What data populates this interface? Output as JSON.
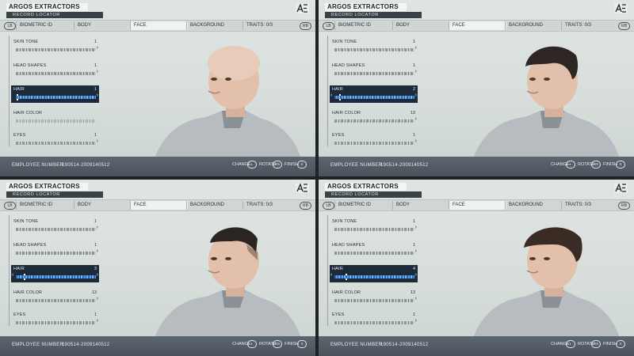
{
  "brand": "ARGOS EXTRACTORS",
  "subtitle": "RECORD LOCATOR",
  "tabs": {
    "lb": "LB",
    "rb": "RB",
    "items": [
      "BIOMETRIC ID",
      "BODY",
      "FACE",
      "BACKGROUND",
      "TRAITS: 0/3"
    ],
    "active": "FACE"
  },
  "footer": {
    "employee_label": "EMPLOYEE NUMBER:",
    "employee_value": "190514-2009140512",
    "change": "CHANGE",
    "rotate": "ROTATE",
    "finish": "FINISH",
    "rotate_key": "RS",
    "finish_key": "X"
  },
  "rows_labels": [
    "SKIN TONE",
    "HEAD SHAPES",
    "HAIR",
    "HAIR COLOR",
    "EYES"
  ],
  "panels": [
    {
      "name": "bald",
      "values": [
        "1",
        "1",
        "1",
        "",
        "1"
      ],
      "hair_style": "none"
    },
    {
      "name": "hair-2",
      "values": [
        "1",
        "1",
        "2",
        "13",
        "1"
      ],
      "hair_style": "short"
    },
    {
      "name": "hair-3",
      "values": [
        "1",
        "1",
        "3",
        "13",
        "1"
      ],
      "hair_style": "fade"
    },
    {
      "name": "hair-4",
      "values": [
        "1",
        "1",
        "4",
        "13",
        "1"
      ],
      "hair_style": "swept"
    }
  ],
  "colors": {
    "selected_row": "#1c2a3a",
    "accent_blue": "#5fa1e8",
    "panel_bg": "#dfe5e2",
    "footer_bg": "#4a535b"
  }
}
